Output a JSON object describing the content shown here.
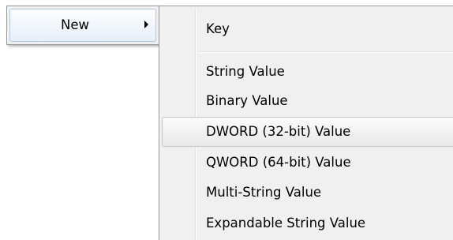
{
  "parent_menu": {
    "item_label": "New"
  },
  "submenu": {
    "items": [
      {
        "label": "Key"
      },
      {
        "label": "String Value"
      },
      {
        "label": "Binary Value"
      },
      {
        "label": "DWORD (32-bit) Value"
      },
      {
        "label": "QWORD (64-bit) Value"
      },
      {
        "label": "Multi-String Value"
      },
      {
        "label": "Expandable String Value"
      }
    ],
    "highlighted": "DWORD (32-bit) Value"
  }
}
